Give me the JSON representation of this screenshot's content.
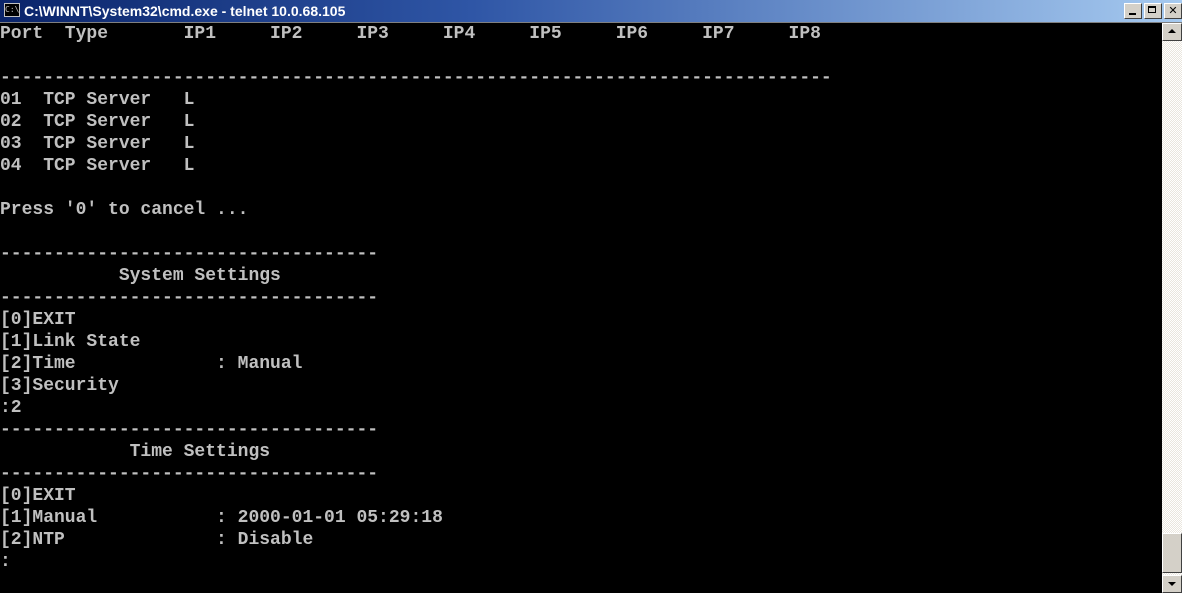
{
  "window": {
    "title": "C:\\WINNT\\System32\\cmd.exe - telnet 10.0.68.105",
    "icon": "cmd-icon",
    "app_icon_text": "C:\\"
  },
  "console": {
    "text_color": "#c0c0c0",
    "background": "#000000",
    "lines": [
      "Port  Type       IP1     IP2     IP3     IP4     IP5     IP6     IP7     IP8",
      "",
      "-----------------------------------------------------------------------------",
      "01  TCP Server   L",
      "02  TCP Server   L",
      "03  TCP Server   L",
      "04  TCP Server   L",
      "",
      "Press '0' to cancel ...",
      "",
      "-----------------------------------",
      "           System Settings",
      "-----------------------------------",
      "[0]EXIT",
      "[1]Link State",
      "[2]Time             : Manual",
      "[3]Security",
      ":2",
      "-----------------------------------",
      "            Time Settings",
      "-----------------------------------",
      "[0]EXIT",
      "[1]Manual           : 2000-01-01 05:29:18",
      "[2]NTP              : Disable",
      ":"
    ]
  },
  "scrollbar": {
    "up_icon": "scroll-up-arrow-icon",
    "down_icon": "scroll-down-arrow-icon"
  }
}
